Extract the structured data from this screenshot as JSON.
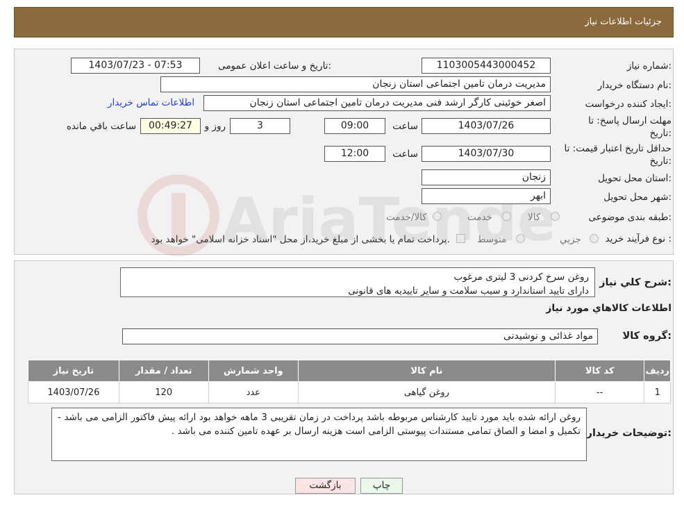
{
  "header": {
    "title": "جزئیات اطلاعات نیاز"
  },
  "form": {
    "need_number_label": "شماره نیاز:",
    "need_number": "1103005443000452",
    "announce_label": "تاریخ و ساعت اعلان عمومی:",
    "announce_value": "1403/07/23 - 07:53",
    "buyer_org_label": "نام دستگاه خریدار:",
    "buyer_org": "مدیریت درمان تامین اجتماعی استان زنجان",
    "creator_label": "ایجاد کننده درخواست:",
    "creator": "اصغر خوئینی کارگر ارشد فنی مدیریت درمان تامین اجتماعی استان زنجان",
    "contact_link": "اطلاعات تماس خریدار",
    "deadline_label_1": "مهلت ارسال پاسخ: تا",
    "deadline_label_2": "تاریخ:",
    "deadline_date": "1403/07/26",
    "time_label": "ساعت",
    "deadline_time": "09:00",
    "days_value": "3",
    "days_label": "روز و",
    "remaining_value": "00:49:27",
    "remaining_label": "ساعت باقي مانده",
    "validity_label_1": "حداقل تاریخ اعتبار قیمت: تا",
    "validity_label_2": "تاریخ:",
    "validity_date": "1403/07/30",
    "validity_time": "12:00",
    "province_label": "استان محل تحویل:",
    "province": "زنجان",
    "city_label": "شهر محل تحویل:",
    "city": "ابهر",
    "category_label": "طبقه بندی موضوعی:",
    "category_options": [
      "کالا",
      "خدمت",
      "کالا/خدمت"
    ],
    "process_label": "نوع فرآیند خرید :",
    "process_options": [
      "جزیي",
      "متوسط"
    ],
    "process_note": "پرداخت تمام یا بخشی از مبلغ خرید،از محل \"اسناد خزانه اسلامی\" خواهد بود."
  },
  "watermark": {
    "text": "AriaTender.neT"
  },
  "description": {
    "label": "شرح كلي نياز:",
    "text": "روغن سرخ کردنی 3 لیتری  مرغوب\nدارای تایید استاندارد و سیب سلامت و سایر تاییدیه های قانونی"
  },
  "goods_section": {
    "title": "اطلاعات كالاهاي مورد نياز",
    "group_label": "گروه كالا:",
    "group_value": "مواد غذائی و نوشیدنی"
  },
  "table": {
    "headers": [
      "رديف",
      "كد كالا",
      "نام كالا",
      "واحد شمارش",
      "تعداد / مقدار",
      "تاريخ نياز"
    ],
    "rows": [
      [
        "1",
        "--",
        "روغن گیاهی",
        "عدد",
        "120",
        "1403/07/26"
      ]
    ]
  },
  "buyer_notes": {
    "label": "توضيحات خريدار:",
    "text": "روغن ارائه شده باید مورد تایید کارشناس مربوطه باشد  پرداخت در زمان تقریبی 3 ماهه خواهد بود  ارائه پیش فاکتور الزامی می باشد - تکمیل و امضا و الصاق تمامی مستندات پیوستی الزامی است  هزینه ارسال بر عهده تامین کننده می باشد ."
  },
  "buttons": {
    "print": "چاپ",
    "back": "بازگشت"
  }
}
